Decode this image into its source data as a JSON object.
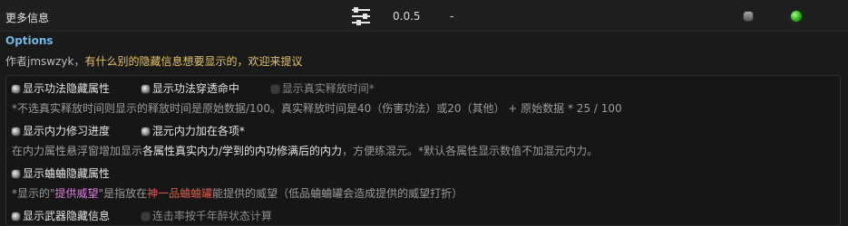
{
  "header": {
    "title": "更多信息",
    "version": "0.0.5",
    "dash": "-",
    "settings_icon": "sliders-icon",
    "toggle_icon": "toggle-dot-icon",
    "status_icon": "status-green-icon",
    "status_color": "#2aa51b"
  },
  "options_title": "Options",
  "author": {
    "prefix": "作者jmswzyk，",
    "message": "有什么别的隐藏信息想要显示的，欢迎来提议"
  },
  "rows": {
    "r1": {
      "opt1": {
        "label": "显示功法隐藏属性",
        "checked": true
      },
      "opt2": {
        "label": "显示功法穿透命中",
        "checked": true
      },
      "opt3": {
        "label": "显示真实释放时间*",
        "checked": false
      }
    },
    "n1": "*不选真实释放时间则显示的释放时间是原始数据/100。真实释放时间是40（伤害功法）或20（其他） + 原始数据 * 25 / 100",
    "r2": {
      "opt1": {
        "label": "显示内力修习进度",
        "checked": true
      },
      "opt2": {
        "label": "混元内力加在各项*",
        "checked": true
      }
    },
    "n2": {
      "a": "在内力属性悬浮窗增加显示",
      "b": "各属性真实内力/学到的内功修满后的内力",
      "c": "，方便练混元。*默认各属性显示数值不加混元内力。"
    },
    "r3": {
      "opt1": {
        "label": "显示蛐蛐隐藏属性",
        "checked": true
      }
    },
    "n3": {
      "a": "*显示的\"",
      "b": "提供威望",
      "c": "\"是指放在",
      "d": "神一品蛐蛐罐",
      "e": "能提供的威望（低品蛐蛐罐会造成提供的威望打折）"
    },
    "r4": {
      "opt1": {
        "label": "显示武器隐藏信息",
        "checked": true
      },
      "opt2": {
        "label": "连击率按千年醉状态计算",
        "checked": false
      }
    }
  }
}
